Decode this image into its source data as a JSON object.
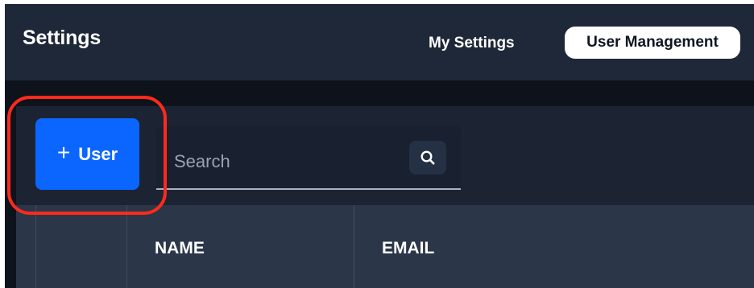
{
  "header": {
    "title": "Settings",
    "tabs": [
      {
        "label": "My Settings",
        "active": false
      },
      {
        "label": "User Management",
        "active": true
      }
    ]
  },
  "toolbar": {
    "add_user_label": "User",
    "add_user_icon": "plus-icon",
    "search": {
      "placeholder": "Search",
      "value": "",
      "icon": "search-icon"
    }
  },
  "table": {
    "columns": [
      "",
      "NAME",
      "EMAIL"
    ]
  },
  "colors": {
    "accent": "#0a66ff",
    "annotation": "#ff2a1c",
    "header_bg": "#1f2838",
    "panel_bg": "#232d3e"
  }
}
